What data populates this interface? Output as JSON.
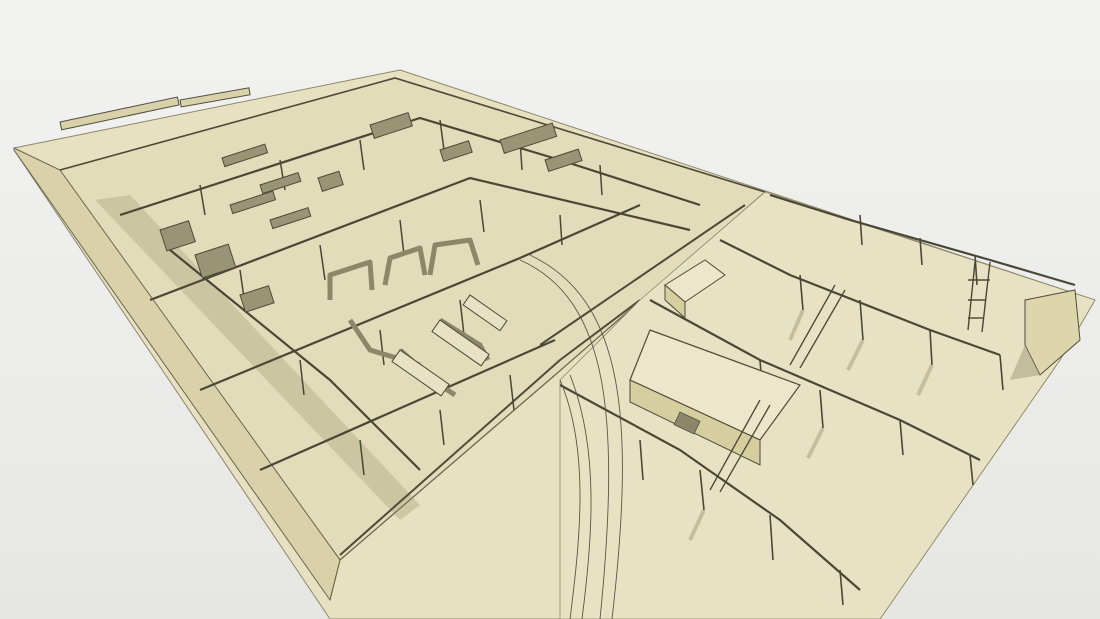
{
  "viewport": {
    "background": "#eeeeec",
    "model_fill": "#e6e0bf",
    "model_fill_light": "#ece7ca",
    "model_fill_dark": "#cfc89e",
    "line_color": "#5a5640",
    "shadow_color": "#9d9877"
  }
}
